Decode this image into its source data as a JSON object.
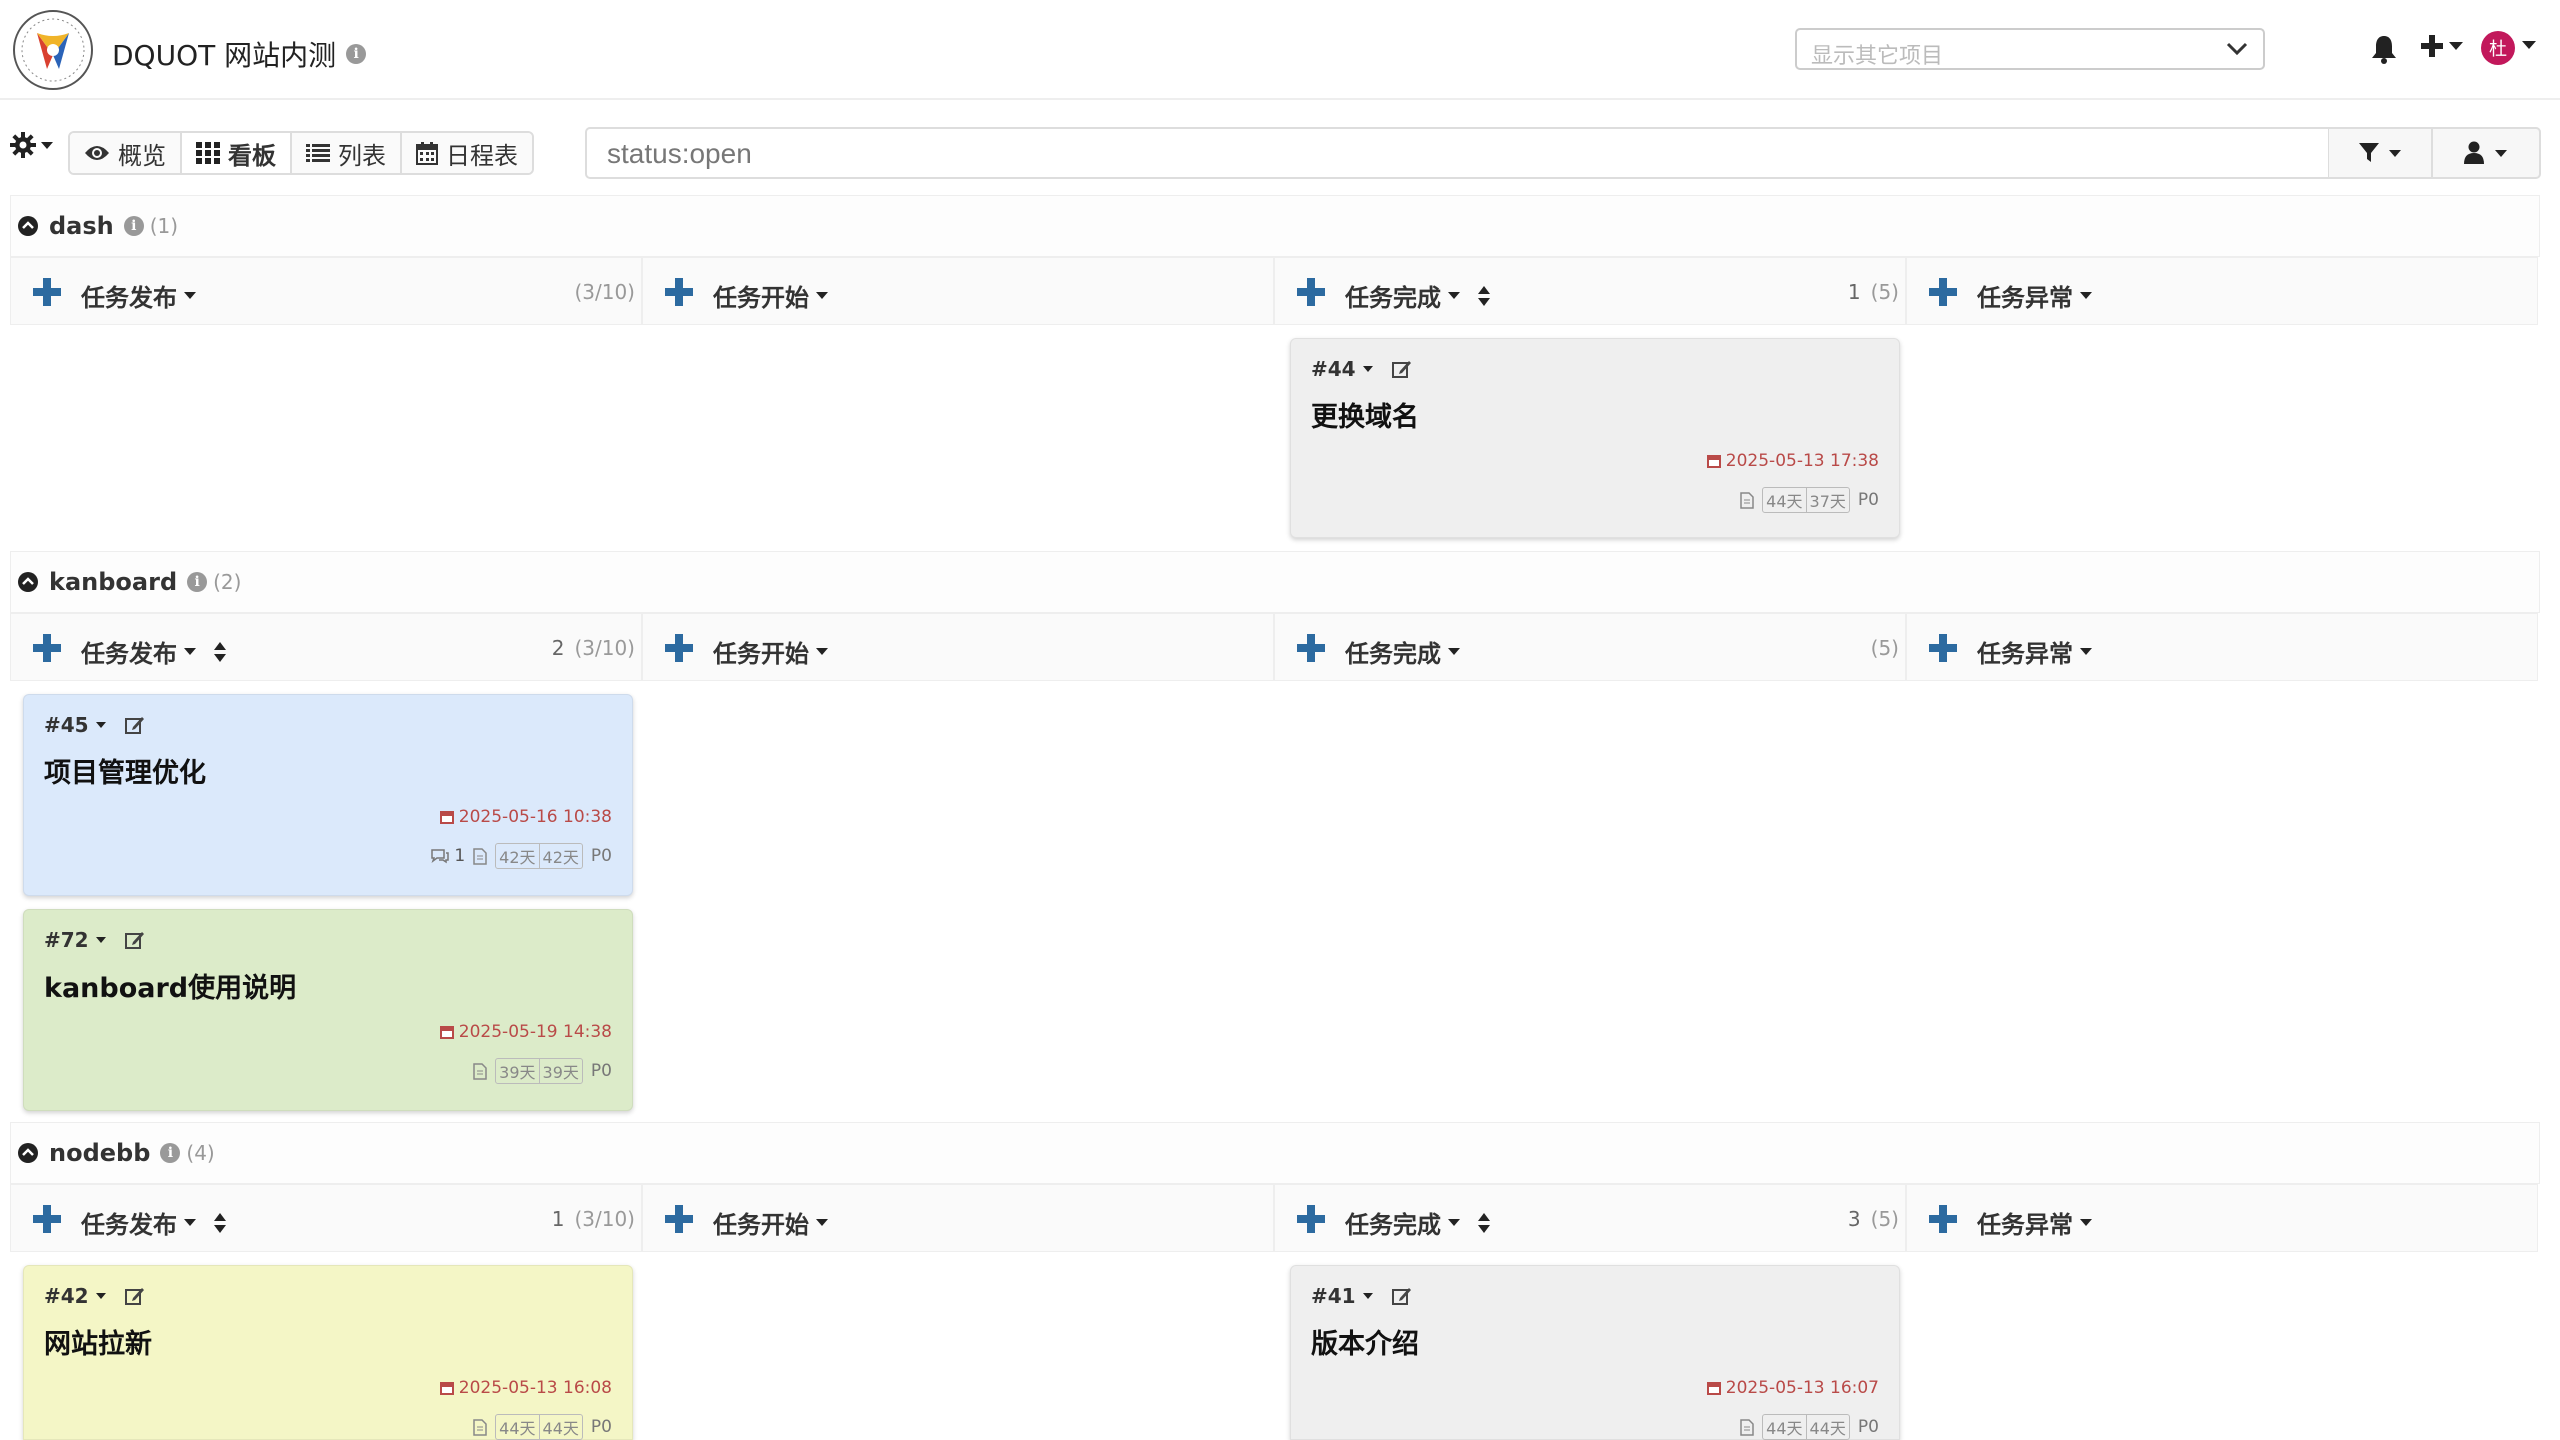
{
  "header": {
    "project_title": "DQUOT 网站内测",
    "project_select_placeholder": "显示其它项目",
    "avatar_initial": "杜"
  },
  "toolbar": {
    "views": [
      {
        "label": "概览",
        "icon": "eye-icon"
      },
      {
        "label": "看板",
        "icon": "grid-icon",
        "active": true
      },
      {
        "label": "列表",
        "icon": "list-icon"
      },
      {
        "label": "日程表",
        "icon": "calendar-icon"
      }
    ],
    "search_value": "status:open"
  },
  "columns": [
    "任务发布",
    "任务开始",
    "任务完成",
    "任务异常"
  ],
  "swimlanes": [
    {
      "name": "dash",
      "count": "(1)",
      "col_counts": [
        {
          "num": "",
          "limit": "(3/10)"
        },
        {
          "num": "",
          "limit": ""
        },
        {
          "num": "1",
          "limit": "(5)"
        },
        {
          "num": "",
          "limit": ""
        }
      ],
      "cards": [
        {
          "id": "#44",
          "title": "更换域名",
          "due": "2025-05-13 17:38",
          "days_a": "44天",
          "days_b": "37天",
          "priority": "P0",
          "comments": "",
          "color": "#efefef",
          "column": 2
        }
      ]
    },
    {
      "name": "kanboard",
      "count": "(2)",
      "col_counts": [
        {
          "num": "2",
          "limit": "(3/10)"
        },
        {
          "num": "",
          "limit": ""
        },
        {
          "num": "",
          "limit": "(5)"
        },
        {
          "num": "",
          "limit": ""
        }
      ],
      "cards": [
        {
          "id": "#45",
          "title": "项目管理优化",
          "due": "2025-05-16 10:38",
          "days_a": "42天",
          "days_b": "42天",
          "priority": "P0",
          "comments": "1",
          "color": "#dbe9fb",
          "column": 0
        },
        {
          "id": "#72",
          "title": "kanboard使用说明",
          "due": "2025-05-19 14:38",
          "days_a": "39天",
          "days_b": "39天",
          "priority": "P0",
          "comments": "",
          "color": "#dcebc9",
          "column": 0
        }
      ]
    },
    {
      "name": "nodebb",
      "count": "(4)",
      "col_counts": [
        {
          "num": "1",
          "limit": "(3/10)"
        },
        {
          "num": "",
          "limit": ""
        },
        {
          "num": "3",
          "limit": "(5)"
        },
        {
          "num": "",
          "limit": ""
        }
      ],
      "cards": [
        {
          "id": "#42",
          "title": "网站拉新",
          "due": "2025-05-13 16:08",
          "days_a": "44天",
          "days_b": "44天",
          "priority": "P0",
          "comments": "",
          "color": "#f4f6c6",
          "column": 0
        },
        {
          "id": "#41",
          "title": "版本介绍",
          "due": "2025-05-13 16:07",
          "days_a": "44天",
          "days_b": "44天",
          "priority": "P0",
          "comments": "",
          "color": "#efefef",
          "column": 2
        }
      ]
    }
  ],
  "colors": {
    "accent_blue": "#2c6aa0",
    "due_red": "#b94a48",
    "avatar_bg": "#c2185b"
  }
}
